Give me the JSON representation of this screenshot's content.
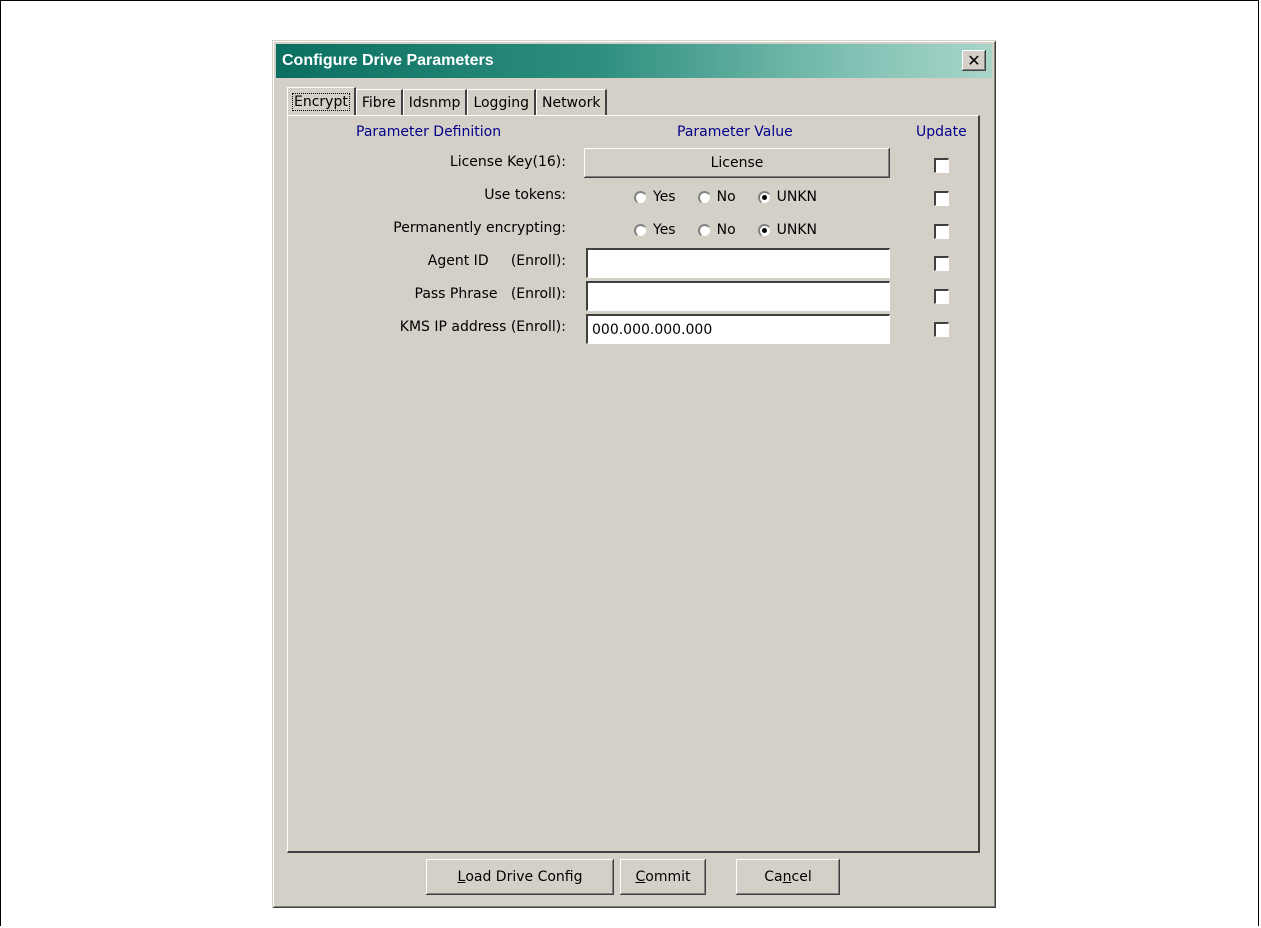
{
  "dialog": {
    "title": "Configure Drive Parameters",
    "close_glyph": "✕"
  },
  "tabs": [
    {
      "label": "Encrypt",
      "active": true
    },
    {
      "label": "Fibre",
      "active": false
    },
    {
      "label": "Idsnmp",
      "active": false
    },
    {
      "label": "Logging",
      "active": false
    },
    {
      "label": "Network",
      "active": false
    }
  ],
  "headers": {
    "definition": "Parameter Definition",
    "value": "Parameter Value",
    "update": "Update"
  },
  "rows": {
    "license_key": {
      "label": "License Key(16):",
      "button": "License",
      "update": false
    },
    "use_tokens": {
      "label": "Use tokens:",
      "options": [
        "Yes",
        "No",
        "UNKN"
      ],
      "selected": "UNKN",
      "update": false
    },
    "perm_encrypting": {
      "label": "Permanently encrypting:",
      "options": [
        "Yes",
        "No",
        "UNKN"
      ],
      "selected": "UNKN",
      "update": false
    },
    "agent_id": {
      "label": "Agent ID     (Enroll):",
      "value": "",
      "update": false
    },
    "pass_phrase": {
      "label": "Pass Phrase   (Enroll):",
      "value": "",
      "update": false
    },
    "kms_ip": {
      "label": "KMS IP address (Enroll):",
      "value": "000.000.000.000",
      "update": false
    }
  },
  "buttons": {
    "load": {
      "prefix": "",
      "mnemonic": "L",
      "rest": "oad Drive Config"
    },
    "commit": {
      "prefix": "",
      "mnemonic": "C",
      "rest": "ommit"
    },
    "cancel": {
      "prefix": "Ca",
      "mnemonic": "n",
      "rest": "cel"
    }
  },
  "colors": {
    "face": "#d4d0c8",
    "header_text": "#00008b",
    "title_start": "#0a6f61",
    "title_end": "#a9d5c9"
  }
}
